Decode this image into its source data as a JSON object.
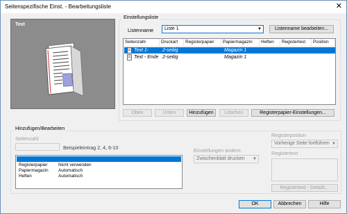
{
  "window": {
    "title": "Seitenspezifische Einst. - Bearbeitungsliste",
    "close_glyph": "✕"
  },
  "preview": {
    "label": "Text"
  },
  "settings_list": {
    "legend": "Einstellungsliste",
    "list_name_label": "Listenname",
    "list_name_value": "Liste 1",
    "edit_list_name_button": "Listenname bearbeiten...",
    "columns": [
      "Seitenzahl",
      "Druckart",
      "Registerpapier",
      "Papiermagazin",
      "Heften",
      "Registertext",
      "Position"
    ],
    "rows": [
      {
        "page": "Text 1-",
        "print_type": "2-seitig",
        "tab_paper": "",
        "magazine": "Magazin 1",
        "staple": "",
        "tab_text": "",
        "position": "",
        "selected": true
      },
      {
        "page": "Text - Ende",
        "print_type": "2-seitig",
        "tab_paper": "",
        "magazine": "Magazin 1",
        "staple": "",
        "tab_text": "",
        "position": "",
        "selected": false
      }
    ],
    "buttons": {
      "up": "Oben",
      "down": "Unten",
      "add": "Hinzufügen",
      "delete": "Löschen",
      "tab_paper_settings": "Registerpapier-Einstellungen..."
    }
  },
  "add_edit": {
    "legend": "Hinzufügen/Bearbeiten",
    "page_number_label": "Seitenzahl",
    "page_number_value": "",
    "page_number_example": "Beispieleintrag 2, 4, 6-10",
    "properties": [
      {
        "key": "",
        "value": "",
        "selected": true
      },
      {
        "key": "Registerpapier",
        "value": "Nicht verwenden",
        "selected": false
      },
      {
        "key": "Papiermagazin",
        "value": "Automatisch",
        "selected": false
      },
      {
        "key": "Heften",
        "value": "Automatisch",
        "selected": false
      }
    ],
    "change_settings_label": "Einstellungen ändern:",
    "change_settings_value": "Zwischenblatt drucken",
    "tab_position_label": "Registerpostion",
    "tab_position_value": "Vorherige Seite fortführen",
    "tab_text_label": "Registertext",
    "tab_text_details_button": "Registertext - Details..."
  },
  "footer": {
    "ok": "OK",
    "cancel": "Abbrechen",
    "help": "Hilfe"
  },
  "colors": {
    "selection": "#0078d7",
    "preview_bg": "#8c8c8c",
    "window_border": "#6e8fb5"
  }
}
